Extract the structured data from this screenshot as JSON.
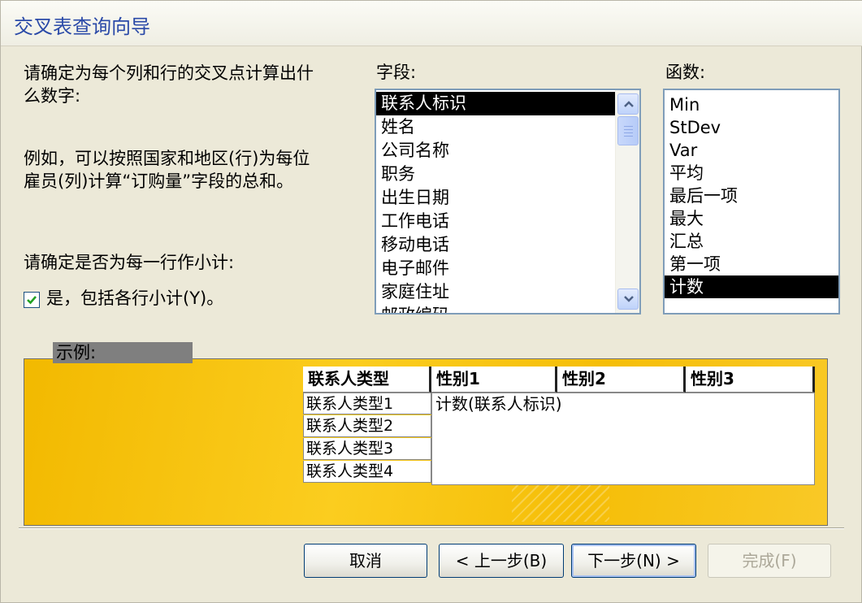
{
  "window": {
    "title": "交叉表查询向导"
  },
  "instructions": {
    "line1": "请确定为每个列和行的交叉点计算出什",
    "line2": "么数字:",
    "example1": "例如，可以按照国家和地区(行)为每位",
    "example2": "雇员(列)计算“订购量”字段的总和。",
    "subtotal_question": "请确定是否为每一行作小计:"
  },
  "subtotal_checkbox": {
    "label": "是，包括各行小计(Y)。",
    "checked": true
  },
  "fields": {
    "label": "字段:",
    "items": [
      "联系人标识",
      "姓名",
      "公司名称",
      "职务",
      "出生日期",
      "工作电话",
      "移动电话",
      "电子邮件",
      "家庭住址",
      "邮政编码"
    ],
    "selected": "联系人标识"
  },
  "functions": {
    "label": "函数:",
    "items": [
      "Min",
      "StDev",
      "Var",
      "平均",
      "最后一项",
      "最大",
      "汇总",
      "第一项",
      "计数"
    ],
    "selected": "计数"
  },
  "sample": {
    "label": "示例:",
    "row_header": "联系人类型",
    "column_headers": [
      "性别1",
      "性别2",
      "性别3"
    ],
    "rows": [
      "联系人类型1",
      "联系人类型2",
      "联系人类型3",
      "联系人类型4"
    ],
    "cell_value": "计数(联系人标识)"
  },
  "buttons": {
    "cancel": "取消",
    "back": "< 上一步(B)",
    "next": "下一步(N) >",
    "finish": "完成(F)"
  },
  "colors": {
    "title": "#2b4aa8",
    "sample_background": "#f5be08",
    "selection": "#000000"
  }
}
